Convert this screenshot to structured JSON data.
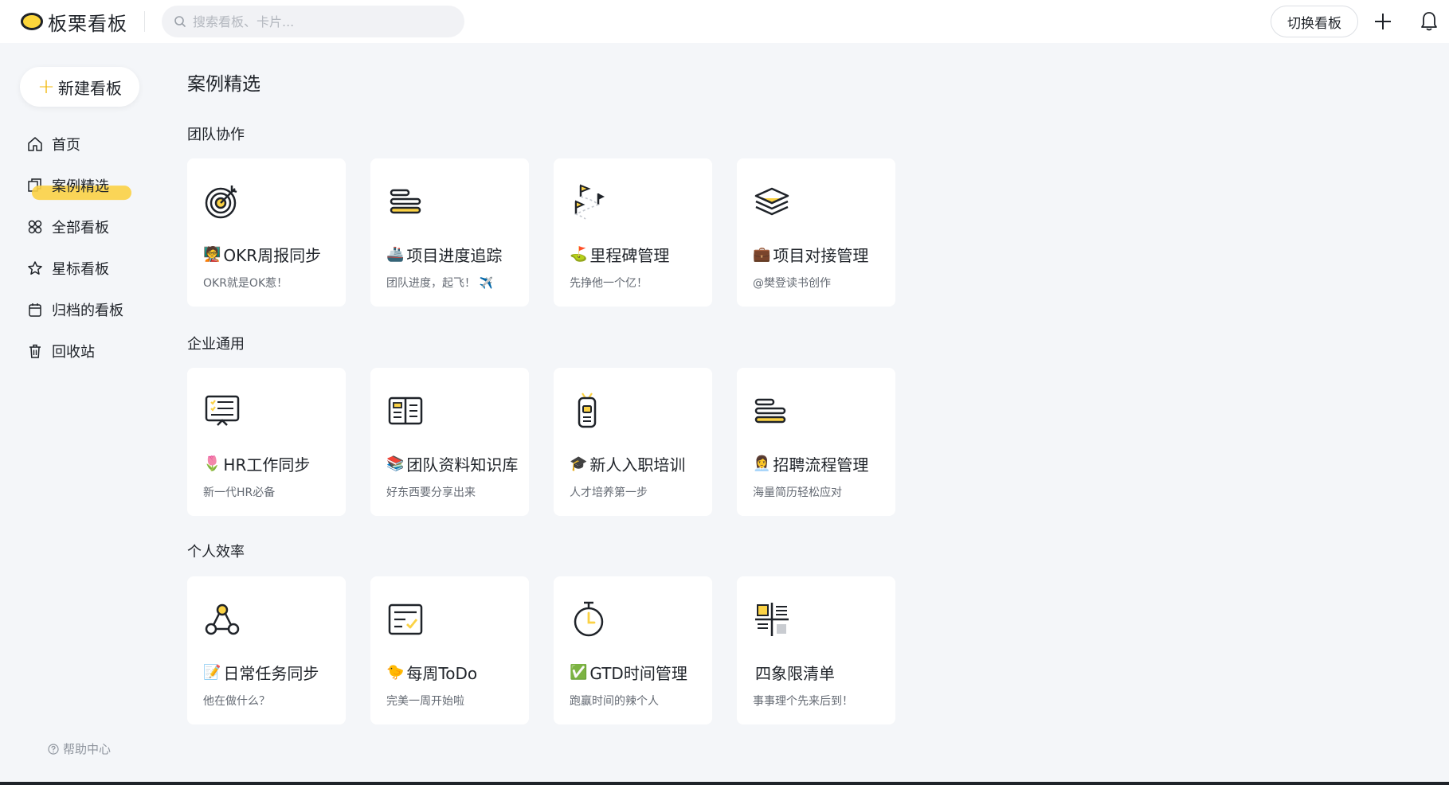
{
  "header": {
    "logo_text": "板栗看板",
    "search_placeholder": "搜索看板、卡片...",
    "switch_board_label": "切换看板"
  },
  "sidebar": {
    "new_board_label": "新建看板",
    "items": [
      {
        "label": "首页",
        "icon": "home-icon"
      },
      {
        "label": "案例精选",
        "icon": "copy-icon",
        "active": true
      },
      {
        "label": "全部看板",
        "icon": "grid-icon"
      },
      {
        "label": "星标看板",
        "icon": "star-icon"
      },
      {
        "label": "归档的看板",
        "icon": "archive-icon"
      },
      {
        "label": "回收站",
        "icon": "trash-icon"
      }
    ],
    "help_label": "帮助中心"
  },
  "main": {
    "page_title": "案例精选",
    "sections": [
      {
        "title": "团队协作",
        "cards": [
          {
            "emoji": "🧑‍🏫",
            "title": "OKR周报同步",
            "desc": "OKR就是OK惹！",
            "icon": "target-icon"
          },
          {
            "emoji": "🚢",
            "title": "项目进度追踪",
            "desc": "团队进度，起飞！ ✈️",
            "icon": "progress-bars-icon"
          },
          {
            "emoji": "⛳",
            "title": "里程碑管理",
            "desc": "先挣他一个亿！",
            "icon": "milestone-flags-icon"
          },
          {
            "emoji": "💼",
            "title": "项目对接管理",
            "desc": "@樊登读书创作",
            "icon": "layers-icon"
          }
        ]
      },
      {
        "title": "企业通用",
        "cards": [
          {
            "emoji": "🌷",
            "title": "HR工作同步",
            "desc": "新一代HR必备",
            "icon": "presentation-board-icon"
          },
          {
            "emoji": "📚",
            "title": "团队资料知识库",
            "desc": "好东西要分享出来",
            "icon": "open-book-icon"
          },
          {
            "emoji": "🎓",
            "title": "新人入职培训",
            "desc": "人才培养第一步",
            "icon": "badge-icon"
          },
          {
            "emoji": "👩‍💼",
            "title": "招聘流程管理",
            "desc": "海量简历轻松应对",
            "icon": "progress-bars-icon"
          }
        ]
      },
      {
        "title": "个人效率",
        "cards": [
          {
            "emoji": "📝",
            "title": "日常任务同步",
            "desc": "他在做什么？",
            "icon": "network-icon"
          },
          {
            "emoji": "🐤",
            "title": "每周ToDo",
            "desc": "完美一周开始啦",
            "icon": "checklist-icon"
          },
          {
            "emoji": "✅",
            "title": "GTD时间管理",
            "desc": "跑赢时间的辣个人",
            "icon": "stopwatch-icon"
          },
          {
            "emoji": "",
            "title": "四象限清单",
            "desc": "事事理个先来后到！",
            "icon": "quadrant-icon"
          }
        ]
      }
    ]
  },
  "colors": {
    "accent": "#fbd245",
    "background": "#f4f6f9",
    "text": "#1f2329"
  }
}
